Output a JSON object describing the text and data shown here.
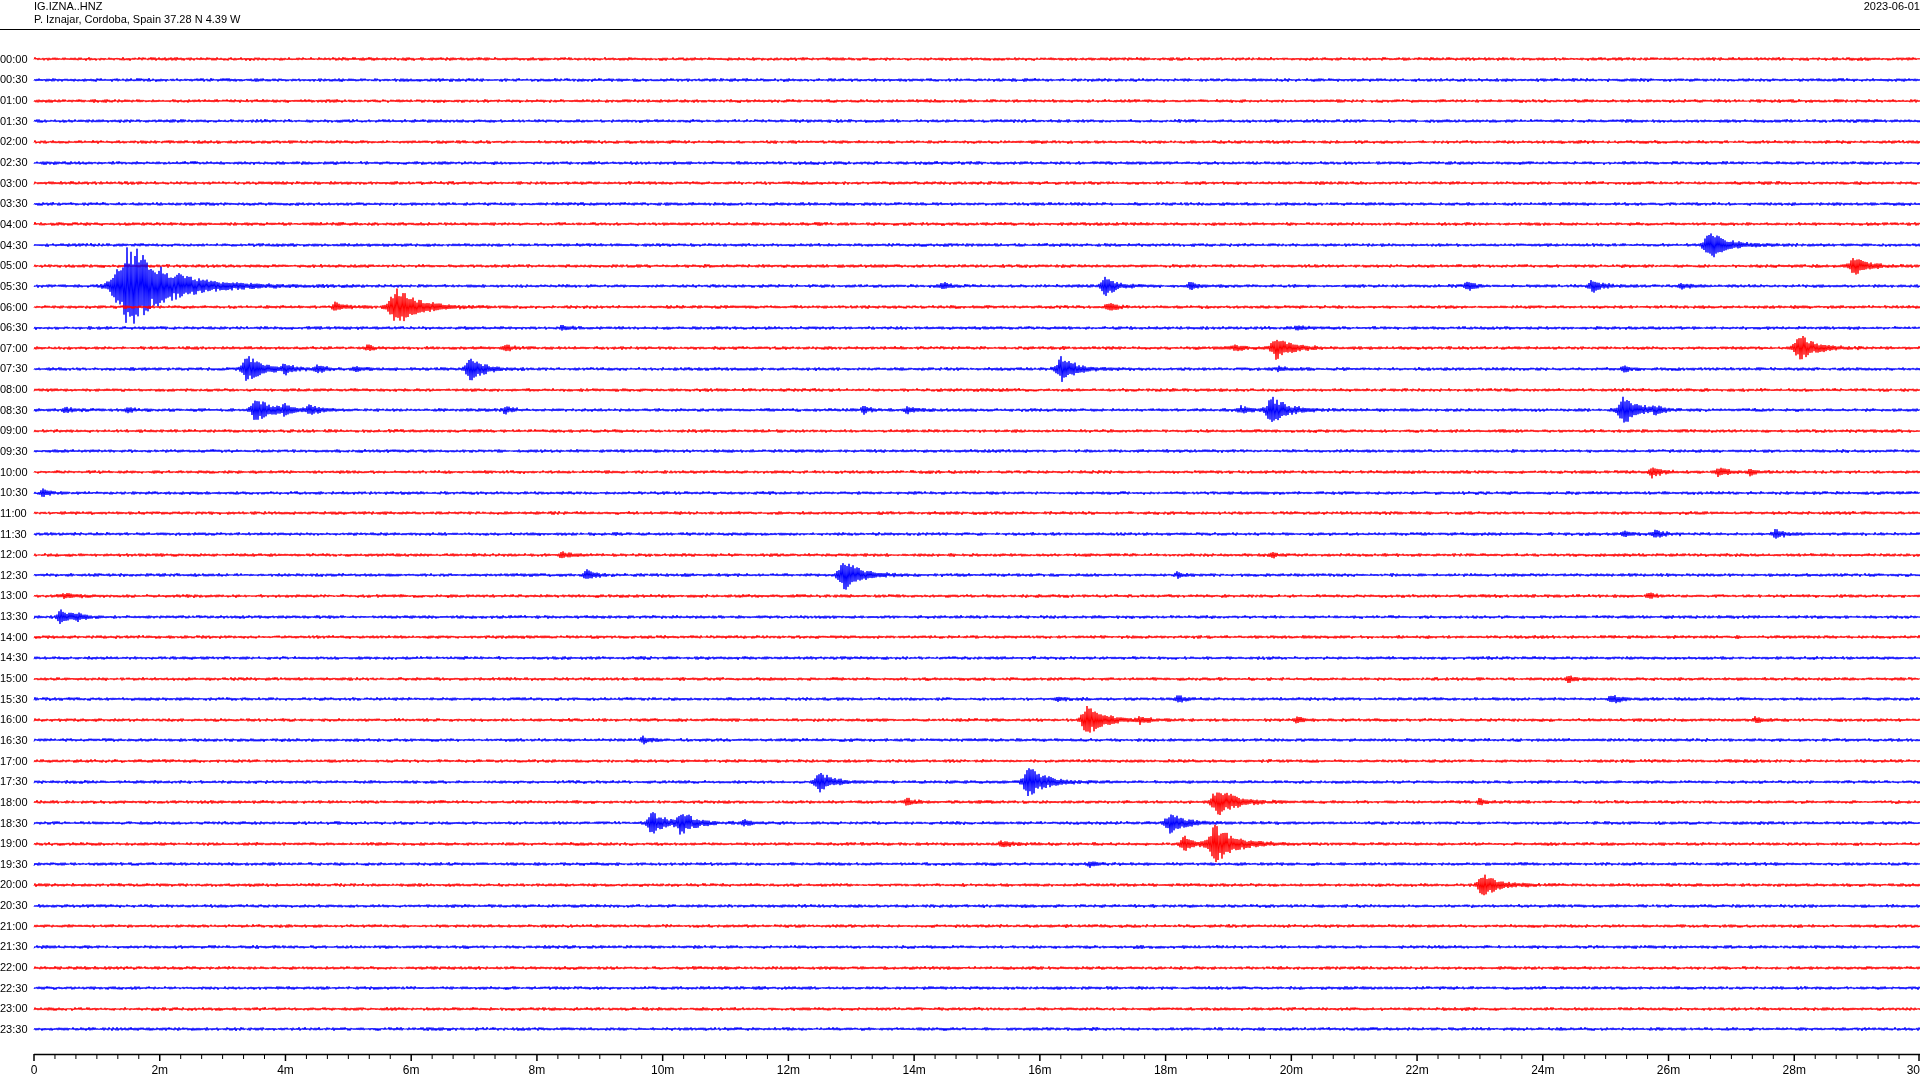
{
  "header": {
    "station": "IG.IZNA..HNZ",
    "location": "P. Iznajar, Cordoba, Spain  37.28 N 4.39 W",
    "date": "2023-06-01"
  },
  "rows": [
    {
      "label": "00:00",
      "color": "#ff0000"
    },
    {
      "label": "00:30",
      "color": "#0000ff"
    },
    {
      "label": "01:00",
      "color": "#ff0000"
    },
    {
      "label": "01:30",
      "color": "#0000ff"
    },
    {
      "label": "02:00",
      "color": "#ff0000"
    },
    {
      "label": "02:30",
      "color": "#0000ff"
    },
    {
      "label": "03:00",
      "color": "#ff0000"
    },
    {
      "label": "03:30",
      "color": "#0000ff"
    },
    {
      "label": "04:00",
      "color": "#ff0000"
    },
    {
      "label": "04:30",
      "color": "#0000ff"
    },
    {
      "label": "05:00",
      "color": "#ff0000"
    },
    {
      "label": "05:30",
      "color": "#0000ff"
    },
    {
      "label": "06:00",
      "color": "#ff0000"
    },
    {
      "label": "06:30",
      "color": "#0000ff"
    },
    {
      "label": "07:00",
      "color": "#ff0000"
    },
    {
      "label": "07:30",
      "color": "#0000ff"
    },
    {
      "label": "08:00",
      "color": "#ff0000"
    },
    {
      "label": "08:30",
      "color": "#0000ff"
    },
    {
      "label": "09:00",
      "color": "#ff0000"
    },
    {
      "label": "09:30",
      "color": "#0000ff"
    },
    {
      "label": "10:00",
      "color": "#ff0000"
    },
    {
      "label": "10:30",
      "color": "#0000ff"
    },
    {
      "label": "11:00",
      "color": "#ff0000"
    },
    {
      "label": "11:30",
      "color": "#0000ff"
    },
    {
      "label": "12:00",
      "color": "#ff0000"
    },
    {
      "label": "12:30",
      "color": "#0000ff"
    },
    {
      "label": "13:00",
      "color": "#ff0000"
    },
    {
      "label": "13:30",
      "color": "#0000ff"
    },
    {
      "label": "14:00",
      "color": "#ff0000"
    },
    {
      "label": "14:30",
      "color": "#0000ff"
    },
    {
      "label": "15:00",
      "color": "#ff0000"
    },
    {
      "label": "15:30",
      "color": "#0000ff"
    },
    {
      "label": "16:00",
      "color": "#ff0000"
    },
    {
      "label": "16:30",
      "color": "#0000ff"
    },
    {
      "label": "17:00",
      "color": "#ff0000"
    },
    {
      "label": "17:30",
      "color": "#0000ff"
    },
    {
      "label": "18:00",
      "color": "#ff0000"
    },
    {
      "label": "18:30",
      "color": "#0000ff"
    },
    {
      "label": "19:00",
      "color": "#ff0000"
    },
    {
      "label": "19:30",
      "color": "#0000ff"
    },
    {
      "label": "20:00",
      "color": "#ff0000"
    },
    {
      "label": "20:30",
      "color": "#0000ff"
    },
    {
      "label": "21:00",
      "color": "#ff0000"
    },
    {
      "label": "21:30",
      "color": "#0000ff"
    },
    {
      "label": "22:00",
      "color": "#ff0000"
    },
    {
      "label": "22:30",
      "color": "#0000ff"
    },
    {
      "label": "23:00",
      "color": "#ff0000"
    },
    {
      "label": "23:30",
      "color": "#0000ff"
    }
  ],
  "axis": {
    "ticks": [
      "0",
      "2m",
      "4m",
      "6m",
      "8m",
      "10m",
      "12m",
      "14m",
      "16m",
      "18m",
      "20m",
      "22m",
      "24m",
      "26m",
      "28m",
      "30"
    ]
  }
}
